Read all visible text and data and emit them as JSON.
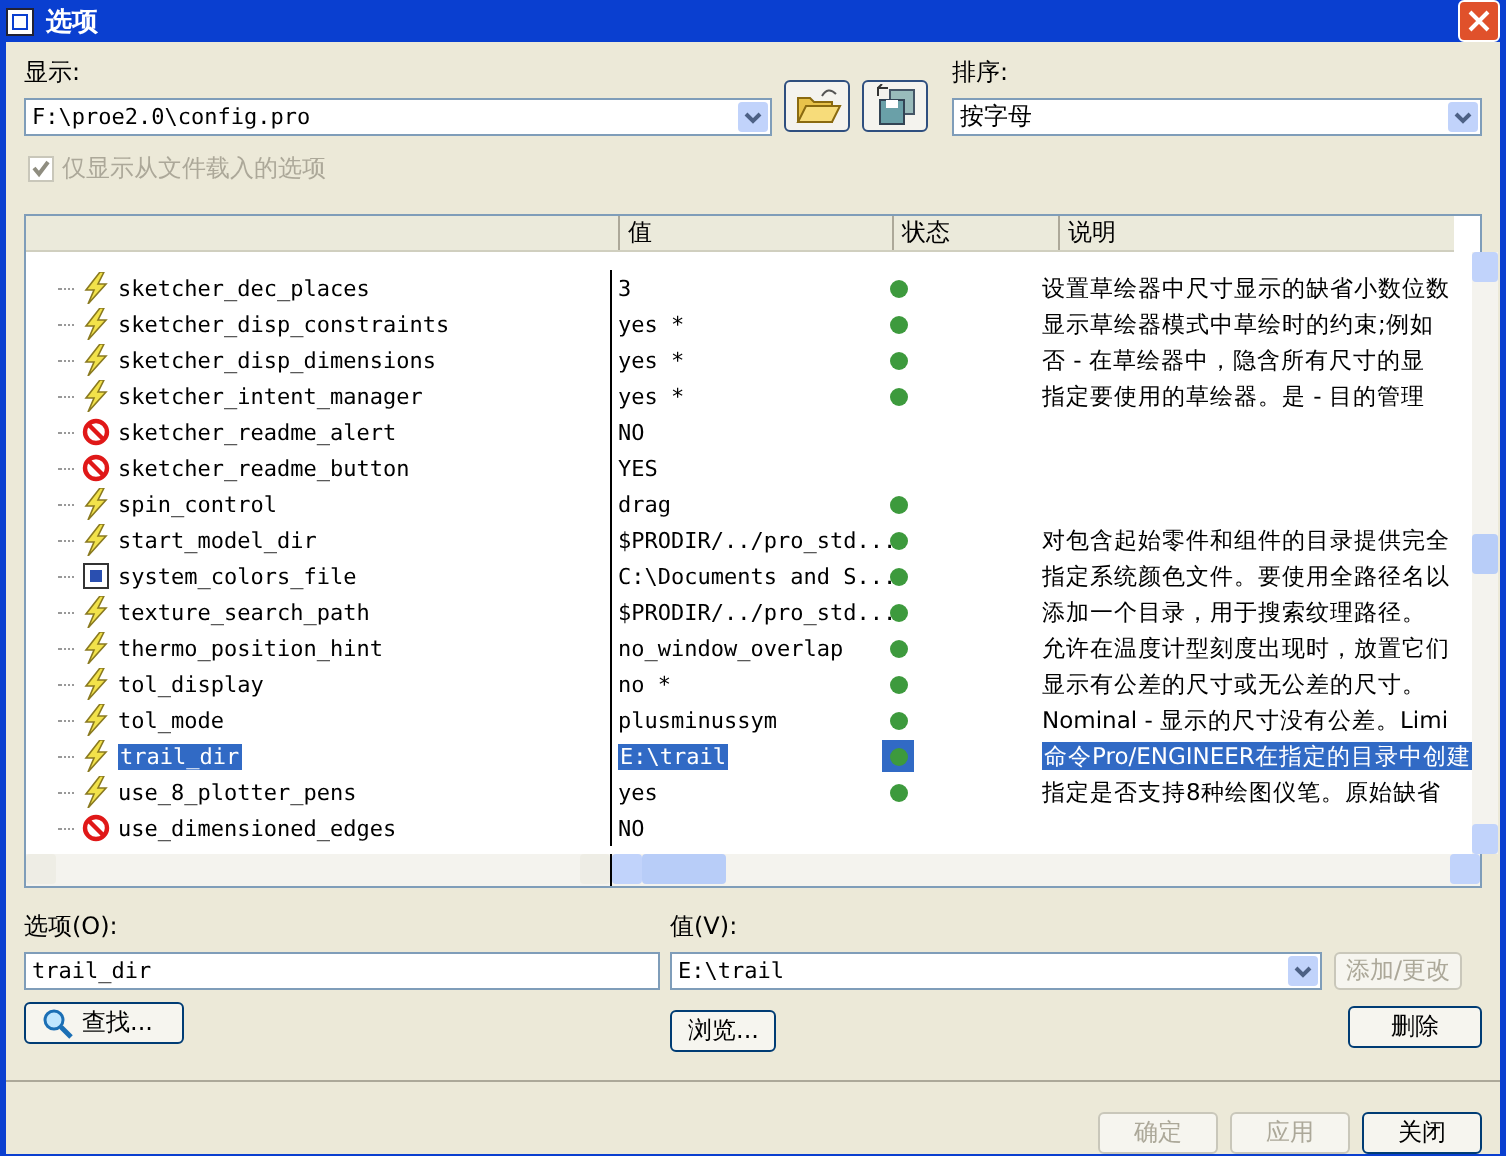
{
  "window": {
    "title": "选项"
  },
  "display": {
    "label": "显示:",
    "value": "F:\\proe2.0\\config.pro"
  },
  "sort": {
    "label": "排序:",
    "value": "按字母"
  },
  "filter_checkbox": {
    "label": "仅显示从文件载入的选项",
    "checked": true,
    "disabled": true
  },
  "table": {
    "columns": [
      "值",
      "状态",
      "说明"
    ],
    "rows": [
      {
        "kind": "setting",
        "name": "sketcher_dec_places",
        "value": "3",
        "active": true,
        "description": "设置草绘器中尺寸显示的缺省小数位数",
        "selected": false
      },
      {
        "kind": "setting",
        "name": "sketcher_disp_constraints",
        "value": "yes *",
        "active": true,
        "description": "显示草绘器模式中草绘时的约束;例如",
        "selected": false
      },
      {
        "kind": "setting",
        "name": "sketcher_disp_dimensions",
        "value": "yes *",
        "active": true,
        "description": "否 - 在草绘器中，隐含所有尺寸的显",
        "selected": false
      },
      {
        "kind": "setting",
        "name": "sketcher_intent_manager",
        "value": "yes *",
        "active": true,
        "description": "指定要使用的草绘器。是 - 目的管理",
        "selected": false
      },
      {
        "kind": "obsolete",
        "name": "sketcher_readme_alert",
        "value": "NO",
        "active": false,
        "selected": false
      },
      {
        "kind": "obsolete",
        "name": "sketcher_readme_button",
        "value": "YES",
        "active": false,
        "selected": false
      },
      {
        "kind": "setting",
        "name": "spin_control",
        "value": "drag",
        "active": true,
        "selected": false
      },
      {
        "kind": "setting",
        "name": "start_model_dir",
        "value": "$PRODIR/../pro_std...",
        "active": true,
        "description": "对包含起始零件和组件的目录提供完全",
        "selected": false
      },
      {
        "kind": "file",
        "name": "system_colors_file",
        "value": "C:\\Documents and S...",
        "active": true,
        "description": "指定系统颜色文件。要使用全路径名以",
        "selected": false
      },
      {
        "kind": "setting",
        "name": "texture_search_path",
        "value": "$PRODIR/../pro_std...",
        "active": true,
        "description": "添加一个目录，用于搜索纹理路径。",
        "selected": false
      },
      {
        "kind": "setting",
        "name": "thermo_position_hint",
        "value": "no_window_overlap",
        "active": true,
        "description": "允许在温度计型刻度出现时，放置它们",
        "selected": false
      },
      {
        "kind": "setting",
        "name": "tol_display",
        "value": "no *",
        "active": true,
        "description": "显示有公差的尺寸或无公差的尺寸。",
        "selected": false
      },
      {
        "kind": "setting",
        "name": "tol_mode",
        "value": "plusminussym",
        "active": true,
        "description": "Nominal - 显示的尺寸没有公差。Limi",
        "selected": false
      },
      {
        "kind": "setting",
        "name": "trail_dir",
        "value": "E:\\trail",
        "active": true,
        "description": "命令Pro/ENGINEER在指定的目录中创建",
        "selected": true
      },
      {
        "kind": "setting",
        "name": "use_8_plotter_pens",
        "value": "yes",
        "active": true,
        "description": "指定是否支持8种绘图仪笔。原始缺省",
        "selected": false
      },
      {
        "kind": "obsolete",
        "name": "use_dimensioned_edges",
        "value": "NO",
        "active": false,
        "selected": false
      }
    ]
  },
  "option_field": {
    "label": "选项(O):",
    "value": "trail_dir"
  },
  "value_field": {
    "label": "值(V):",
    "value": "E:\\trail"
  },
  "find_button": {
    "label": "查找...",
    "disabled": false
  },
  "browse_button": {
    "label": "浏览...",
    "disabled": false
  },
  "add_button": {
    "label": "添加/更改",
    "disabled": true
  },
  "delete_button": {
    "label": "删除",
    "disabled": false
  },
  "footer_buttons": [
    {
      "label": "确定",
      "disabled": true
    },
    {
      "label": "应用",
      "disabled": true
    },
    {
      "label": "关闭",
      "disabled": false
    }
  ]
}
